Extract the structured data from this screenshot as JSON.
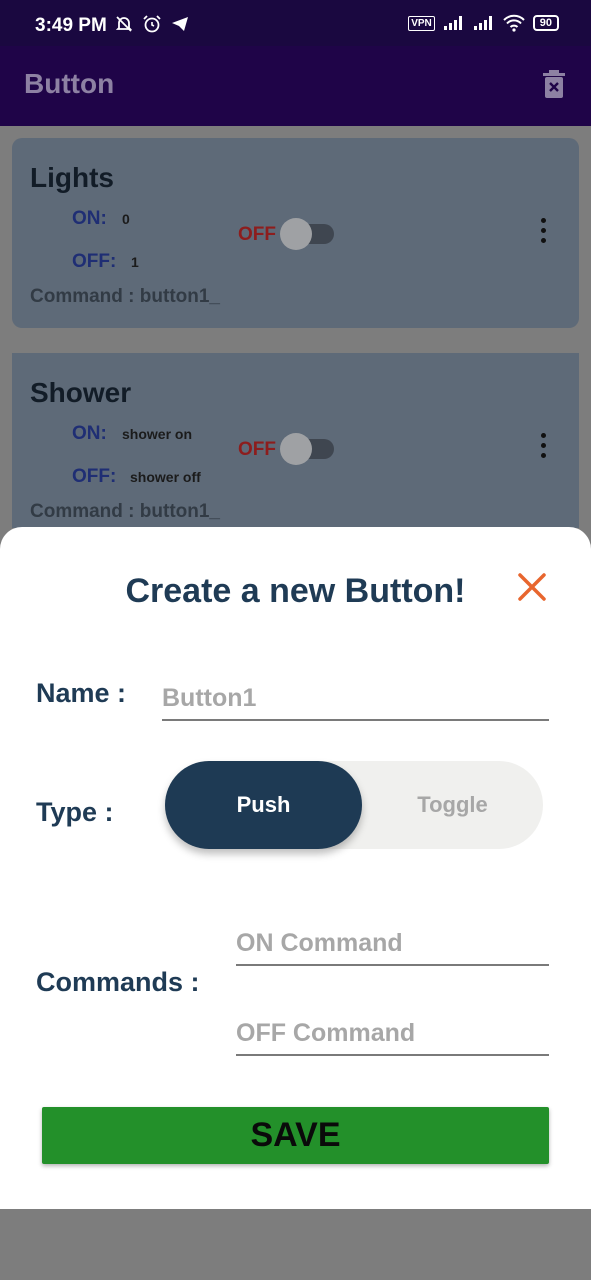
{
  "status_bar": {
    "time": "3:49 PM",
    "vpn": "VPN",
    "battery": "90",
    "icons": [
      "bell-off-icon",
      "alarm-icon",
      "telegram-icon",
      "signal-icon",
      "signal-icon",
      "wifi-icon",
      "battery-icon"
    ]
  },
  "app_bar": {
    "title": "Button",
    "icon": "trash-icon"
  },
  "cards": [
    {
      "title": "Lights",
      "on_label": "ON:",
      "on_value": "0",
      "off_label": "OFF:",
      "off_value": "1",
      "command": "Command : button1_",
      "state_label": "OFF"
    },
    {
      "title": "Shower",
      "on_label": "ON:",
      "on_value": "shower on",
      "off_label": "OFF:",
      "off_value": "shower off",
      "command": "Command : button1_",
      "state_label": "OFF"
    }
  ],
  "sheet": {
    "heading": "Create a new Button!",
    "name_label": "Name :",
    "name_placeholder": "Button1",
    "type_label": "Type :",
    "type_options": [
      "Push",
      "Toggle"
    ],
    "type_selected": "Push",
    "commands_label": "Commands :",
    "on_command_placeholder": "ON Command",
    "off_command_placeholder": "OFF Command",
    "save_label": "SAVE"
  },
  "colors": {
    "app_bar": "#1f0448",
    "heading": "#1f3b55",
    "accent_close": "#e8662e",
    "save": "#23902a"
  }
}
